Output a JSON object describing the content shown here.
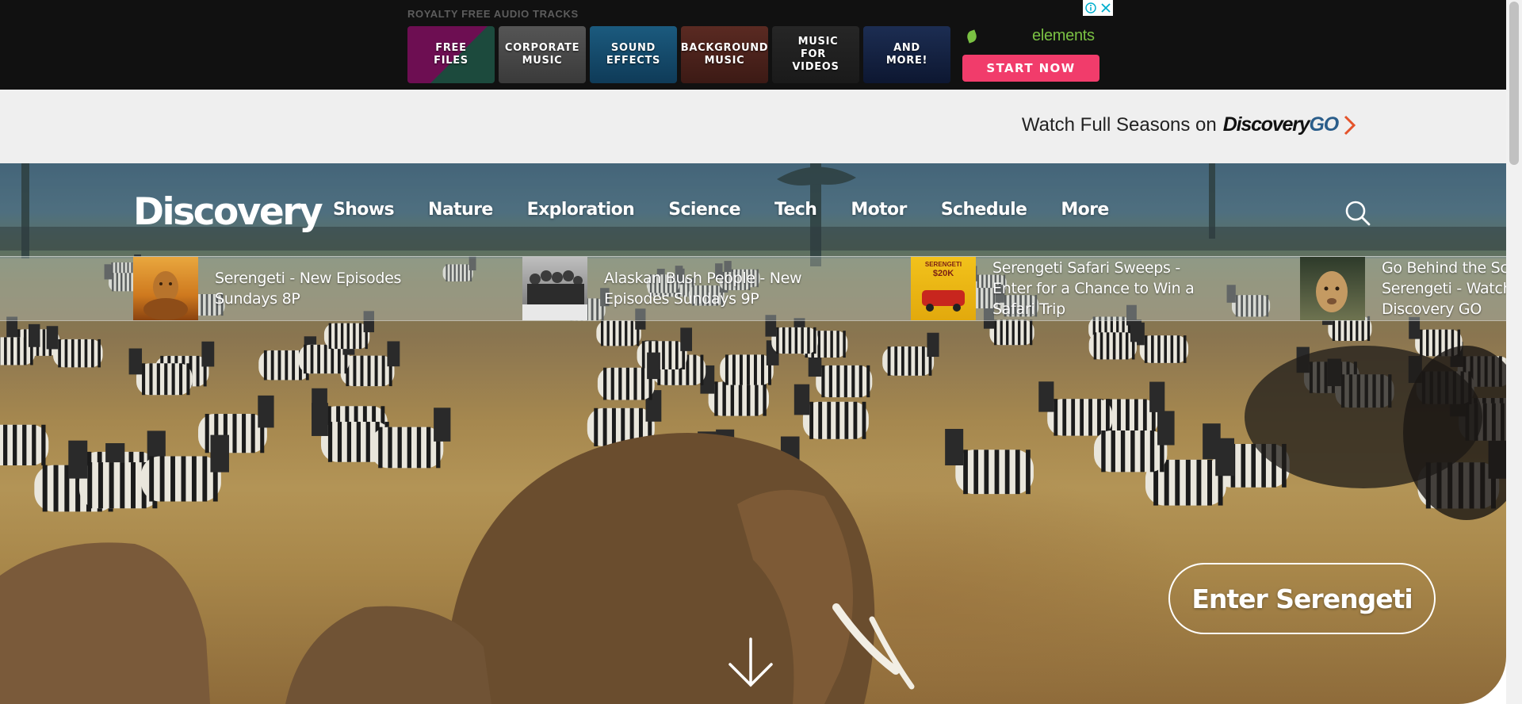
{
  "ad": {
    "label": "ROYALTY FREE AUDIO TRACKS",
    "tiles": [
      {
        "line1": "FREE",
        "line2": "FILES"
      },
      {
        "line1": "CORPORATE",
        "line2": "MUSIC"
      },
      {
        "line1": "SOUND",
        "line2": "EFFECTS"
      },
      {
        "line1": "BACKGROUND",
        "line2": "MUSIC"
      },
      {
        "line1": "MUSIC FOR",
        "line2": "VIDEOS"
      },
      {
        "line1": "AND",
        "line2": "MORE!"
      }
    ],
    "brand": "elements",
    "cta": "START NOW",
    "accent_color": "#f13c6b",
    "brand_color": "#7ac143"
  },
  "watch": {
    "text": "Watch Full Seasons on",
    "logo_main": "Discovery",
    "logo_go": "GO"
  },
  "header": {
    "logo": "Discovery",
    "nav": [
      "Shows",
      "Nature",
      "Exploration",
      "Science",
      "Tech",
      "Motor",
      "Schedule",
      "More"
    ]
  },
  "promos": [
    {
      "title": "Serengeti - New Episodes Sundays 8P"
    },
    {
      "title": "Alaskan Bush People - New Episodes Sundays 9P"
    },
    {
      "title": "Serengeti Safari Sweeps - Enter for a Chance to Win a Safari Trip"
    },
    {
      "title": "Go Behind the Scenes of Serengeti - Watch on Discovery GO"
    }
  ],
  "promo_thumb_text": {
    "sweeps_brand": "SERENGETI",
    "sweeps_amount": "$20K"
  },
  "hero": {
    "cta": "Enter Serengeti"
  }
}
